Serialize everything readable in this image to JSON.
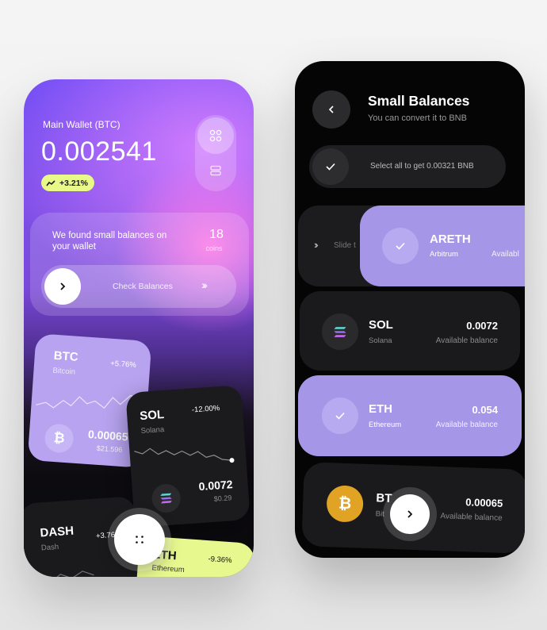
{
  "wallet": {
    "title": "Main Wallet (BTC)",
    "balance": "0.002541",
    "change": "+3.21%"
  },
  "found": {
    "text": "We found small balances on your wallet",
    "count": "18",
    "unit": "coins",
    "button_label": "Check Balances"
  },
  "coins": [
    {
      "symbol": "BTC",
      "name": "Bitcoin",
      "change": "+5.76%",
      "amount": "0.00065",
      "usd": "$21.596"
    },
    {
      "symbol": "SOL",
      "name": "Solana",
      "change": "-12.00%",
      "amount": "0.0072",
      "usd": "$0.29"
    },
    {
      "symbol": "DASH",
      "name": "Dash",
      "change": "+3.76"
    },
    {
      "symbol": "ETH",
      "name": "Ethereum",
      "change": "-9.36%"
    }
  ],
  "small_balances": {
    "title": "Small Balances",
    "subtitle": "You can convert it to BNB",
    "select_all": "Select all to get 0.00321 BNB",
    "slide_label": "Slide t",
    "items": [
      {
        "symbol": "ARETH",
        "name": "Arbitrum",
        "available": "Availabl"
      },
      {
        "symbol": "SOL",
        "name": "Solana",
        "amount": "0.0072",
        "available": "Available balance"
      },
      {
        "symbol": "ETH",
        "name": "Ethereum",
        "amount": "0.054",
        "available": "Available balance"
      },
      {
        "symbol": "BT",
        "name": "Bit",
        "amount": "0.00065",
        "available": "Available balance"
      }
    ]
  },
  "colors": {
    "accent_lime": "#e8f98a",
    "accent_lavender": "#a696e8",
    "btc_orange": "#e1a324"
  }
}
